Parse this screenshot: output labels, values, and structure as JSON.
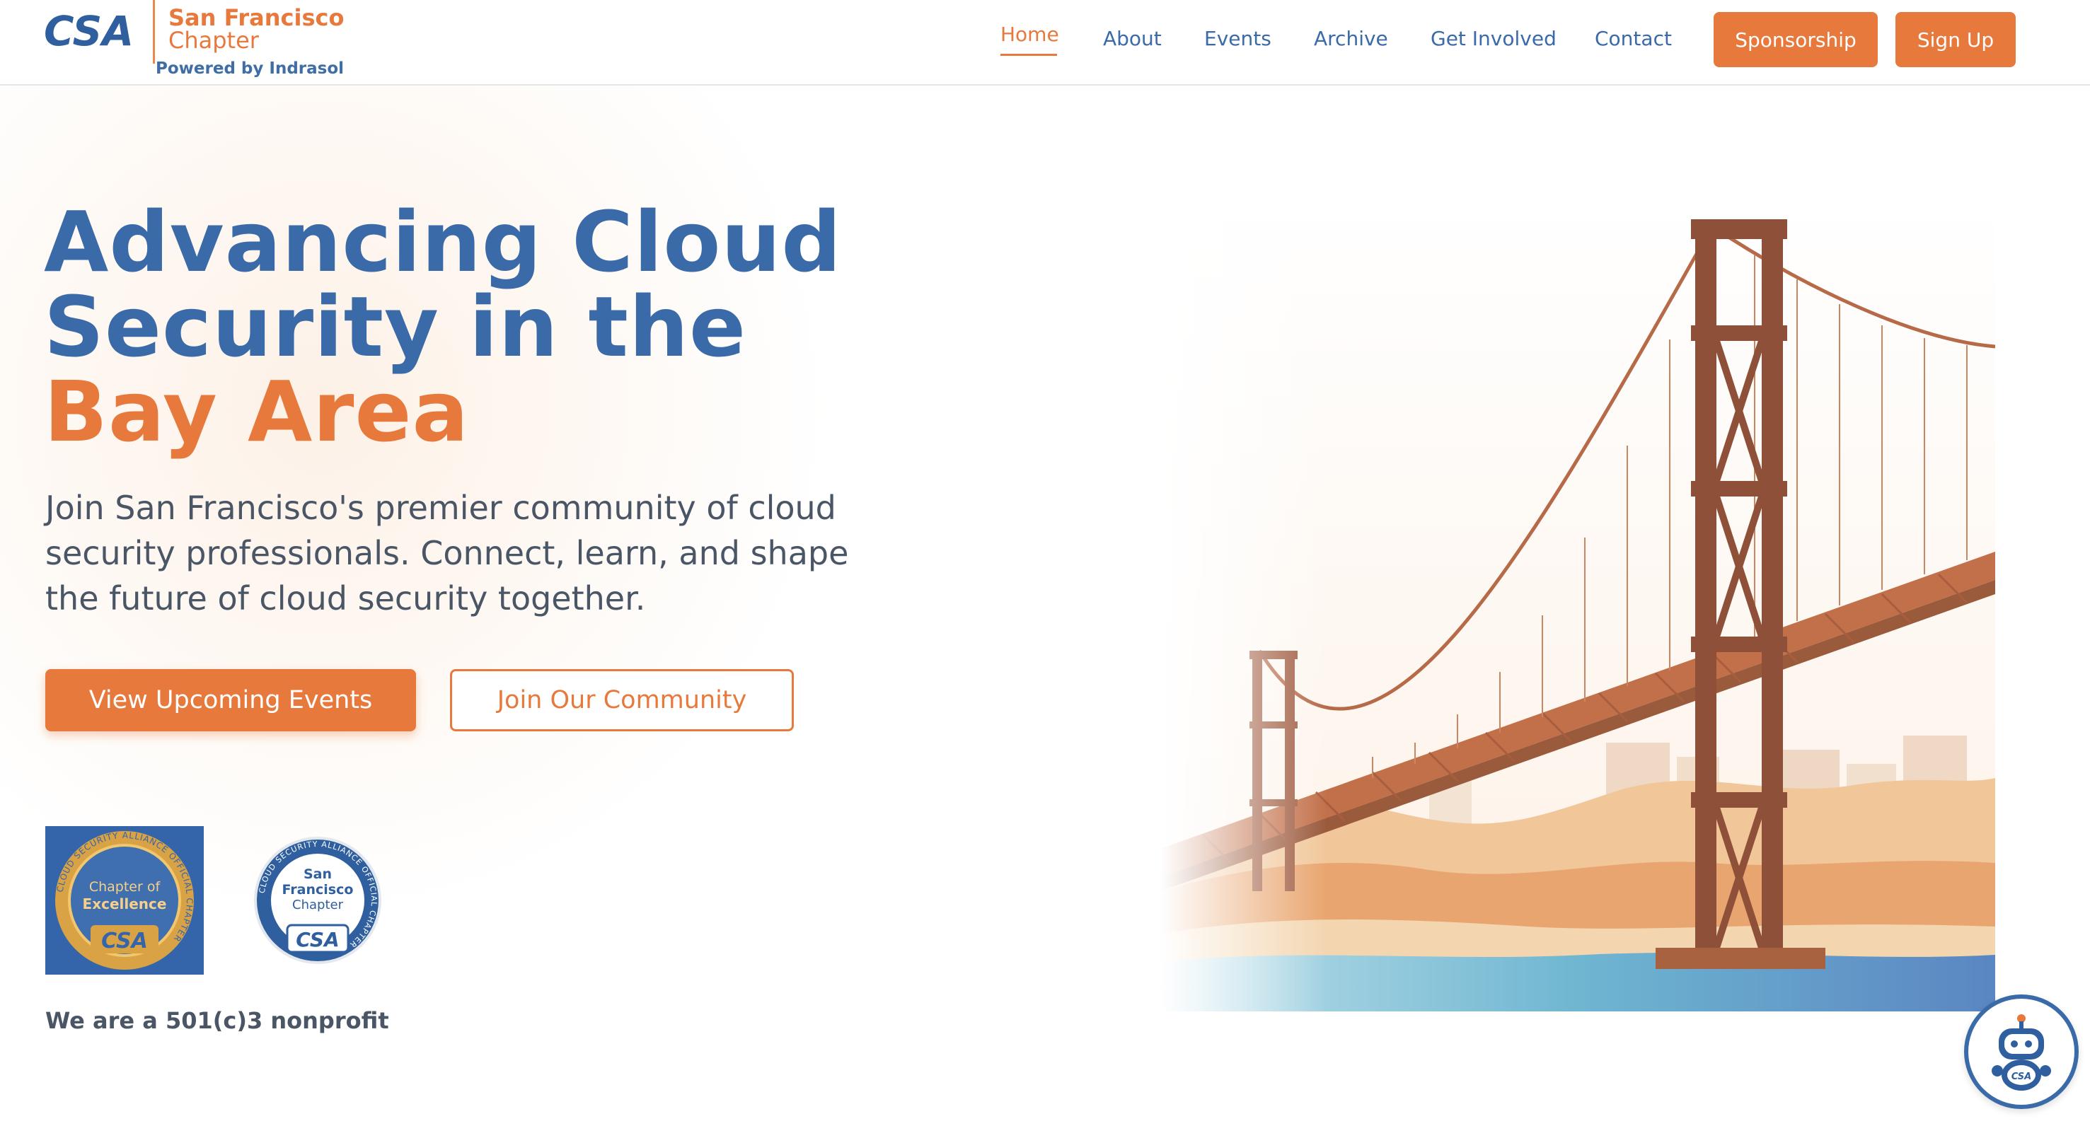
{
  "header": {
    "logo": {
      "mark": "CSA",
      "title": "San Francisco",
      "subtitle": "Chapter",
      "powered_by": "Powered by Indrasol"
    },
    "nav": [
      {
        "label": "Home",
        "active": true
      },
      {
        "label": "About"
      },
      {
        "label": "Events"
      },
      {
        "label": "Archive"
      },
      {
        "label": "Get Involved"
      },
      {
        "label": "Contact"
      }
    ],
    "sponsorship_label": "Sponsorship",
    "signup_label": "Sign Up"
  },
  "hero": {
    "title_part1": "Advancing Cloud Security in the ",
    "title_accent": "Bay Area",
    "description": "Join San Francisco's premier community of cloud security professionals. Connect, learn, and shape the future of cloud security together.",
    "primary_button": "View Upcoming Events",
    "secondary_button": "Join Our Community",
    "badges": {
      "excellence": {
        "ring_text": "CLOUD SECURITY ALLIANCE OFFICIAL CHAPTER",
        "line1": "Chapter of",
        "line2": "Excellence",
        "mark": "CSA"
      },
      "chapter": {
        "ring_text": "CLOUD SECURITY ALLIANCE OFFICIAL CHAPTER",
        "line1": "San",
        "line2": "Francisco",
        "line3": "Chapter",
        "mark": "CSA"
      }
    },
    "nonprofit_text": "We are a 501(c)3 nonprofit"
  },
  "chatbot": {
    "mark": "CSA",
    "icon": "robot-icon"
  },
  "colors": {
    "brand_blue": "#3b6aa8",
    "brand_orange": "#e8793c",
    "text_gray": "#4a5565"
  }
}
